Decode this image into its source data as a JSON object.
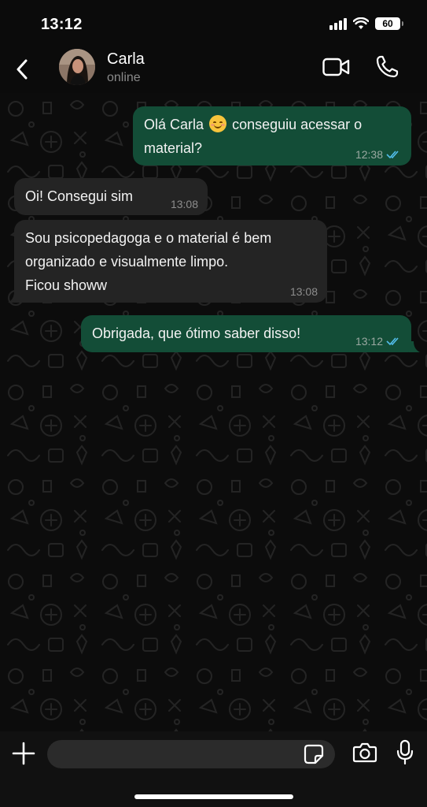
{
  "status_bar": {
    "time": "13:12",
    "battery": "60",
    "icons": [
      "signal-icon",
      "wifi-icon",
      "battery-icon"
    ]
  },
  "header": {
    "contact_name": "Carla",
    "contact_status": "online",
    "icons": [
      "back-arrow-icon",
      "video-call-icon",
      "phone-icon"
    ]
  },
  "messages": [
    {
      "direction": "outgoing",
      "text_before": "Olá Carla",
      "emoji": "smiling-face",
      "text_after": "conseguiu acessar o material?",
      "time": "12:38",
      "read": true
    },
    {
      "direction": "incoming",
      "text": "Oi! Consegui sim",
      "time": "13:08"
    },
    {
      "direction": "incoming",
      "lines": [
        "Sou psicopedagoga e o material é bem",
        "organizado e visualmente limpo.",
        "Ficou showw"
      ],
      "time": "13:08"
    },
    {
      "direction": "outgoing",
      "text": "Obrigada, que ótimo saber disso!",
      "time": "13:12",
      "read": true
    }
  ],
  "composer": {
    "placeholder": "",
    "icons": [
      "plus-icon",
      "sticker-icon",
      "camera-icon",
      "microphone-icon"
    ]
  },
  "colors": {
    "outgoing_bubble": "#134d37",
    "incoming_bubble": "#242424",
    "read_ticks": "#53bdeb",
    "background": "#0b0b0b"
  }
}
